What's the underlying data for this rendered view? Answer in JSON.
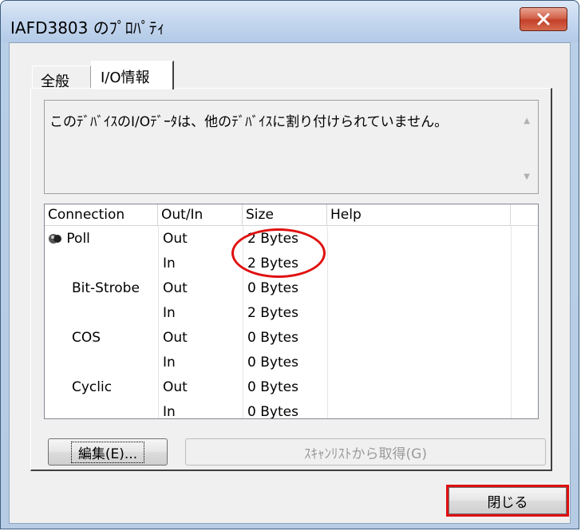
{
  "window": {
    "title": "IAFD3803 のﾌﾟﾛﾊﾟﾃｨ"
  },
  "tabs": [
    {
      "label": "全般",
      "selected": false
    },
    {
      "label": "I/O情報",
      "selected": true
    }
  ],
  "description": "このﾃﾞﾊﾞｲｽのI/Oﾃﾞｰﾀは、他のﾃﾞﾊﾞｲｽに割り付けられていません。",
  "table": {
    "columns": [
      "Connection",
      "Out/In",
      "Size",
      "Help"
    ],
    "rows": [
      {
        "connection": "Poll",
        "dir": "Out",
        "size": "2 Bytes",
        "help": ""
      },
      {
        "connection": "",
        "dir": "In",
        "size": "2 Bytes",
        "help": ""
      },
      {
        "connection": "Bit-Strobe",
        "dir": "Out",
        "size": "0 Bytes",
        "help": ""
      },
      {
        "connection": "",
        "dir": "In",
        "size": "2 Bytes",
        "help": ""
      },
      {
        "connection": "COS",
        "dir": "Out",
        "size": "0 Bytes",
        "help": ""
      },
      {
        "connection": "",
        "dir": "In",
        "size": "0 Bytes",
        "help": ""
      },
      {
        "connection": "Cyclic",
        "dir": "Out",
        "size": "0 Bytes",
        "help": ""
      },
      {
        "connection": "",
        "dir": "In",
        "size": "0 Bytes",
        "help": ""
      }
    ]
  },
  "buttons": {
    "edit": "編集(E)...",
    "scan": "ｽｷｬﾝﾘｽﾄから取得(G)",
    "close": "閉じる"
  },
  "colors": {
    "highlight": "#e01010"
  },
  "icons": {
    "close": "close-icon",
    "connection": "connection-icon"
  }
}
